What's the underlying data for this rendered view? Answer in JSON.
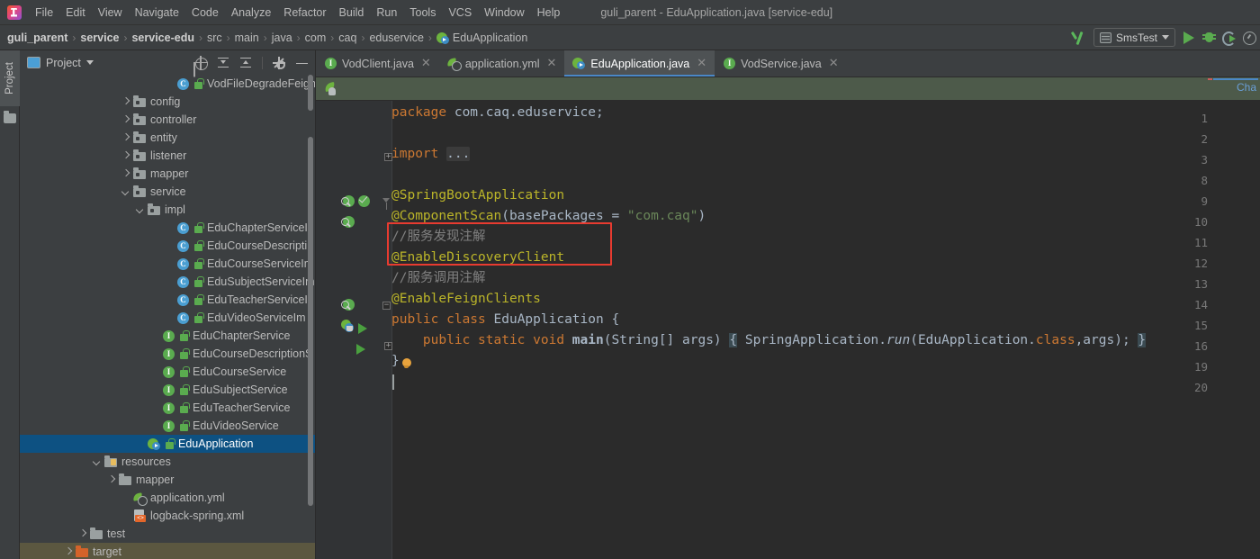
{
  "window": {
    "title": "guli_parent - EduApplication.java [service-edu]",
    "app_icon": "intellij-idea-logo"
  },
  "menubar": {
    "items": [
      {
        "label": "File",
        "mnemonic": "F"
      },
      {
        "label": "Edit",
        "mnemonic": "E"
      },
      {
        "label": "View",
        "mnemonic": "V"
      },
      {
        "label": "Navigate",
        "mnemonic": "N"
      },
      {
        "label": "Code",
        "mnemonic": "C"
      },
      {
        "label": "Analyze",
        "mnemonic": "z"
      },
      {
        "label": "Refactor",
        "mnemonic": "R"
      },
      {
        "label": "Build",
        "mnemonic": "B"
      },
      {
        "label": "Run",
        "mnemonic": "u"
      },
      {
        "label": "Tools",
        "mnemonic": "T"
      },
      {
        "label": "VCS",
        "mnemonic": "V"
      },
      {
        "label": "Window",
        "mnemonic": "W"
      },
      {
        "label": "Help",
        "mnemonic": "H"
      }
    ]
  },
  "navbar": {
    "crumbs": [
      {
        "label": "guli_parent",
        "bold": true,
        "icon": null
      },
      {
        "label": "service",
        "bold": true,
        "icon": null
      },
      {
        "label": "service-edu",
        "bold": true,
        "icon": null
      },
      {
        "label": "src",
        "bold": false,
        "icon": null
      },
      {
        "label": "main",
        "bold": false,
        "icon": null
      },
      {
        "label": "java",
        "bold": false,
        "icon": null
      },
      {
        "label": "com",
        "bold": false,
        "icon": null
      },
      {
        "label": "caq",
        "bold": false,
        "icon": null
      },
      {
        "label": "eduservice",
        "bold": false,
        "icon": null
      },
      {
        "label": "EduApplication",
        "bold": false,
        "icon": "spring-boot-class-icon"
      }
    ],
    "separator": "›",
    "run_config": "SmsTest",
    "actions": [
      {
        "name": "update-project-icon",
        "label": ""
      },
      {
        "name": "run-button",
        "label": ""
      },
      {
        "name": "debug-button",
        "label": ""
      },
      {
        "name": "run-with-coverage-button",
        "label": ""
      },
      {
        "name": "profile-button",
        "label": ""
      }
    ]
  },
  "left_strip": {
    "tab_label": "Project",
    "icons": [
      "project-folder-icon"
    ]
  },
  "project_panel": {
    "title": "Project",
    "tools": [
      {
        "name": "locate-icon"
      },
      {
        "name": "expand-all-icon"
      },
      {
        "name": "collapse-all-icon"
      },
      {
        "name": "settings-gear-icon"
      },
      {
        "name": "hide-panel-icon"
      }
    ],
    "tree": [
      {
        "label": "VodFileDegradeFeignC",
        "indent": 10,
        "arrow": "none",
        "icon": "class-icon",
        "pub": true,
        "state": "normal"
      },
      {
        "label": "config",
        "indent": 7,
        "arrow": "closed",
        "icon": "folder-icon",
        "pub": false,
        "state": "normal"
      },
      {
        "label": "controller",
        "indent": 7,
        "arrow": "closed",
        "icon": "folder-icon",
        "pub": false,
        "state": "normal"
      },
      {
        "label": "entity",
        "indent": 7,
        "arrow": "closed",
        "icon": "folder-icon",
        "pub": false,
        "state": "normal"
      },
      {
        "label": "listener",
        "indent": 7,
        "arrow": "closed",
        "icon": "folder-icon",
        "pub": false,
        "state": "normal"
      },
      {
        "label": "mapper",
        "indent": 7,
        "arrow": "closed",
        "icon": "folder-icon",
        "pub": false,
        "state": "normal"
      },
      {
        "label": "service",
        "indent": 7,
        "arrow": "open",
        "icon": "folder-icon",
        "pub": false,
        "state": "normal"
      },
      {
        "label": "impl",
        "indent": 8,
        "arrow": "open",
        "icon": "folder-icon",
        "pub": false,
        "state": "normal"
      },
      {
        "label": "EduChapterServiceI",
        "indent": 10,
        "arrow": "none",
        "icon": "class-icon",
        "pub": true,
        "state": "normal"
      },
      {
        "label": "EduCourseDescripti",
        "indent": 10,
        "arrow": "none",
        "icon": "class-icon",
        "pub": true,
        "state": "normal"
      },
      {
        "label": "EduCourseServiceIm",
        "indent": 10,
        "arrow": "none",
        "icon": "class-icon",
        "pub": true,
        "state": "normal"
      },
      {
        "label": "EduSubjectServiceIm",
        "indent": 10,
        "arrow": "none",
        "icon": "class-icon",
        "pub": true,
        "state": "normal"
      },
      {
        "label": "EduTeacherServiceI",
        "indent": 10,
        "arrow": "none",
        "icon": "class-icon",
        "pub": true,
        "state": "normal"
      },
      {
        "label": "EduVideoServiceIm",
        "indent": 10,
        "arrow": "none",
        "icon": "class-icon",
        "pub": true,
        "state": "normal"
      },
      {
        "label": "EduChapterService",
        "indent": 9,
        "arrow": "none",
        "icon": "interface-icon",
        "pub": true,
        "state": "normal"
      },
      {
        "label": "EduCourseDescriptionS",
        "indent": 9,
        "arrow": "none",
        "icon": "interface-icon",
        "pub": true,
        "state": "normal"
      },
      {
        "label": "EduCourseService",
        "indent": 9,
        "arrow": "none",
        "icon": "interface-icon",
        "pub": true,
        "state": "normal"
      },
      {
        "label": "EduSubjectService",
        "indent": 9,
        "arrow": "none",
        "icon": "interface-icon",
        "pub": true,
        "state": "normal"
      },
      {
        "label": "EduTeacherService",
        "indent": 9,
        "arrow": "none",
        "icon": "interface-icon",
        "pub": true,
        "state": "normal"
      },
      {
        "label": "EduVideoService",
        "indent": 9,
        "arrow": "none",
        "icon": "interface-icon",
        "pub": true,
        "state": "normal"
      },
      {
        "label": "EduApplication",
        "indent": 8,
        "arrow": "none",
        "icon": "spring-boot-icon",
        "pub": true,
        "state": "selected"
      },
      {
        "label": "resources",
        "indent": 5,
        "arrow": "open",
        "icon": "resources-folder-icon",
        "pub": false,
        "state": "normal"
      },
      {
        "label": "mapper",
        "indent": 6,
        "arrow": "closed",
        "icon": "plain-folder-icon",
        "pub": false,
        "state": "normal"
      },
      {
        "label": "application.yml",
        "indent": 7,
        "arrow": "none",
        "icon": "yml-icon",
        "pub": false,
        "state": "normal"
      },
      {
        "label": "logback-spring.xml",
        "indent": 7,
        "arrow": "none",
        "icon": "xml-icon",
        "pub": false,
        "state": "normal"
      },
      {
        "label": "test",
        "indent": 4,
        "arrow": "closed",
        "icon": "plain-folder-icon",
        "pub": false,
        "state": "normal"
      },
      {
        "label": "target",
        "indent": 3,
        "arrow": "closed",
        "icon": "orange-folder-icon",
        "pub": false,
        "state": "hovered"
      }
    ]
  },
  "editor": {
    "tabs": [
      {
        "label": "VodClient.java",
        "icon": "interface-icon",
        "active": false,
        "closable": true
      },
      {
        "label": "application.yml",
        "icon": "yml-icon",
        "active": false,
        "closable": true
      },
      {
        "label": "EduApplication.java",
        "icon": "spring-boot-icon",
        "active": true,
        "closable": true
      },
      {
        "label": "VodService.java",
        "icon": "interface-icon",
        "active": false,
        "closable": true
      }
    ],
    "breadcrumb_icon": "spring-context-icon",
    "breadcrumb_right_text": "Cha",
    "line_numbers": [
      "1",
      "2",
      "3",
      "8",
      "9",
      "10",
      "11",
      "12",
      "13",
      "14",
      "15",
      "16",
      "19",
      "20"
    ],
    "lines": [
      {
        "num": "1",
        "text": "package com.caq.eduservice;"
      },
      {
        "num": "2",
        "text": ""
      },
      {
        "num": "3",
        "text": "import ..."
      },
      {
        "num": "8",
        "text": ""
      },
      {
        "num": "9",
        "text": "@SpringBootApplication"
      },
      {
        "num": "10",
        "text": "@ComponentScan(basePackages = \"com.caq\")"
      },
      {
        "num": "11",
        "text": "//服务发现注解"
      },
      {
        "num": "12",
        "text": "@EnableDiscoveryClient"
      },
      {
        "num": "13",
        "text": "//服务调用注解"
      },
      {
        "num": "14",
        "text": "@EnableFeignClients"
      },
      {
        "num": "15",
        "text": "public class EduApplication {"
      },
      {
        "num": "16",
        "text": "    public static void main(String[] args) { SpringApplication.run(EduApplication.class,args); }"
      },
      {
        "num": "19",
        "text": "}"
      },
      {
        "num": "20",
        "text": ""
      }
    ],
    "highlight_box": {
      "lines": [
        "11",
        "12"
      ],
      "color": "#e83b30"
    },
    "gutter_icons": [
      {
        "line": "9",
        "icons": [
          "spring-bean-icon",
          "spring-config-ok-icon"
        ]
      },
      {
        "line": "10",
        "icons": [
          "spring-bean-icon"
        ]
      },
      {
        "line": "14",
        "icons": [
          "spring-bean-icon"
        ]
      },
      {
        "line": "15",
        "icons": [
          "spring-boot-run-icon",
          "run-arrow-icon"
        ]
      },
      {
        "line": "16",
        "icons": [
          "run-arrow-icon"
        ]
      },
      {
        "line": "19",
        "icons": [
          "intention-bulb-icon"
        ]
      }
    ]
  },
  "colors": {
    "bg_panel": "#3c3f41",
    "bg_editor": "#2b2b2b",
    "bg_gutter": "#313335",
    "accent_blue": "#4a88c7",
    "selection_blue": "#0d5182",
    "hover_olive": "#5b5740",
    "keyword_orange": "#cc7832",
    "annotation_yellow": "#bbb529",
    "string_green": "#6a8759",
    "comment_grey": "#808080",
    "text_default": "#a9b7c6",
    "highlight_red": "#e83b30",
    "spring_green": "#6db33f"
  }
}
